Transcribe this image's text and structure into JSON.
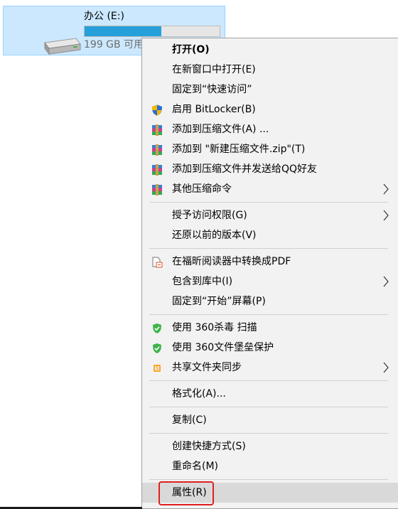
{
  "drive": {
    "name": "办公 (E:)",
    "space": "199 GB 可用",
    "usage_fraction": 0.57,
    "colors": {
      "tile_bg": "#cce8ff",
      "bar_fill": "#26a0da"
    }
  },
  "menu": {
    "open": "打开(O)",
    "open_new_window": "在新窗口中打开(E)",
    "pin_quick_access": "固定到“快速访问”",
    "bitlocker": "启用 BitLocker(B)",
    "add_archive": "添加到压缩文件(A) ...",
    "add_to_zip": "添加到 \"新建压缩文件.zip\"(T)",
    "add_send_qq": "添加到压缩文件并发送给QQ好友",
    "other_compress": "其他压缩命令",
    "grant_access": "授予访问权限(G)",
    "restore_versions": "还原以前的版本(V)",
    "foxit_pdf": "在福昕阅读器中转换成PDF",
    "include_library": "包含到库中(I)",
    "pin_start": "固定到“开始”屏幕(P)",
    "scan_360": "使用 360杀毒 扫描",
    "vault_360": "使用 360文件堡垒保护",
    "share_sync": "共享文件夹同步",
    "format": "格式化(A)...",
    "copy": "复制(C)",
    "create_shortcut": "创建快捷方式(S)",
    "rename": "重命名(M)",
    "properties": "属性(R)"
  },
  "icons": {
    "bitlocker": "shield-icon",
    "archive": "winrar-icon",
    "foxit": "pdf-convert-icon",
    "antivirus_360": "360-shield-icon",
    "sync": "sync-icon",
    "submenu": "chevron-right-icon"
  },
  "colors": {
    "menu_bg": "#f2f2f2",
    "hover_bg": "#d9d9d9",
    "highlight": "#e02020"
  }
}
